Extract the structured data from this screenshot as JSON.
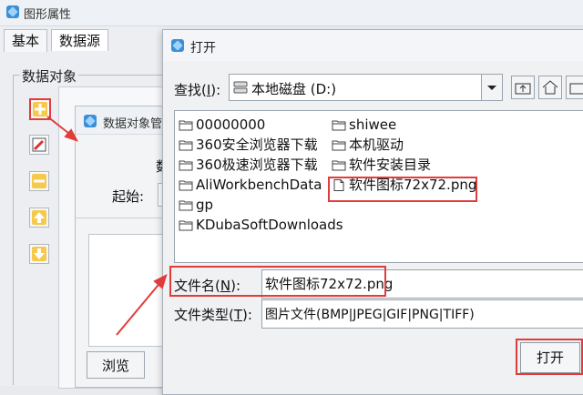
{
  "main_window": {
    "title": "图形属性",
    "tabs": [
      {
        "label": "基本"
      },
      {
        "label": "数据源"
      }
    ],
    "group_label": "数据对象"
  },
  "data_object_dialog": {
    "title": "数据对象管",
    "partial_label": "数",
    "start_label": "起始:",
    "browse_label": "浏览"
  },
  "open_dialog": {
    "title": "打开",
    "look_in_label_prefix": "查找(",
    "look_in_hotkey": "I",
    "look_in_label_suffix": "):",
    "look_in_value": "本地磁盘 (D:)",
    "files_col1": [
      {
        "name": "00000000",
        "icon": "folder-icon"
      },
      {
        "name": "360安全浏览器下载",
        "icon": "folder-icon"
      },
      {
        "name": "360极速浏览器下载",
        "icon": "folder-icon"
      },
      {
        "name": "AliWorkbenchData",
        "icon": "folder-icon"
      },
      {
        "name": "gp",
        "icon": "folder-icon"
      },
      {
        "name": "KDubaSoftDownloads",
        "icon": "folder-icon"
      }
    ],
    "files_col2": [
      {
        "name": "shiwee",
        "icon": "folder-icon"
      },
      {
        "name": "本机驱动",
        "icon": "folder-icon"
      },
      {
        "name": "软件安装目录",
        "icon": "folder-icon"
      },
      {
        "name": "软件图标72x72.png",
        "icon": "file-icon"
      }
    ],
    "filename_label_prefix": "文件名(",
    "filename_hotkey": "N",
    "filename_label_suffix": "):",
    "filename_value": "软件图标72x72.png",
    "filetype_label_prefix": "文件类型(",
    "filetype_hotkey": "T",
    "filetype_label_suffix": "):",
    "filetype_value": "图片文件(BMP|JPEG|GIF|PNG|TIFF)",
    "open_button": "打开"
  },
  "colors": {
    "highlight_red": "#e23b3b",
    "accent_orange": "#f0a11c"
  }
}
